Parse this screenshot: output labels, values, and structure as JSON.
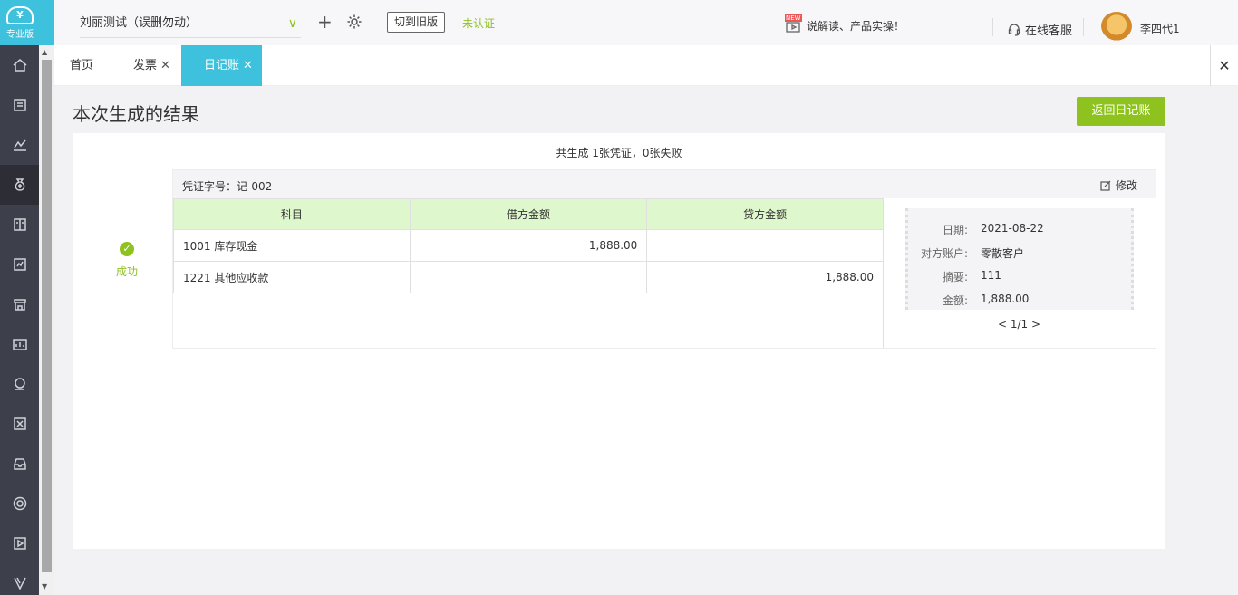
{
  "app": {
    "logo_text": "专业版",
    "company": "刘丽测试（误删勿动）",
    "switch_old_label": "切到旧版",
    "unverified": "未认证",
    "news_tag": "NEW",
    "news_text": "说解读、产品实操！",
    "service_label": "在线客服",
    "username": "李四代1"
  },
  "sidebar": {
    "items": [
      {
        "icon": "home-icon"
      },
      {
        "icon": "invoice-icon"
      },
      {
        "icon": "chart-icon"
      },
      {
        "icon": "money-bag-icon",
        "active": true
      },
      {
        "icon": "ledger-icon"
      },
      {
        "icon": "report-icon"
      },
      {
        "icon": "store-icon"
      },
      {
        "icon": "inventory-icon"
      },
      {
        "icon": "payroll-icon"
      },
      {
        "icon": "tax-icon"
      },
      {
        "icon": "archive-icon"
      },
      {
        "icon": "settings-icon"
      },
      {
        "icon": "video-icon"
      },
      {
        "icon": "v-logo-icon"
      }
    ]
  },
  "tabs": [
    {
      "label": "首页",
      "closable": false
    },
    {
      "label": "发票",
      "closable": true
    },
    {
      "label": "日记账",
      "closable": true,
      "active": true
    }
  ],
  "page": {
    "title": "本次生成的结果",
    "return_button": "返回日记账",
    "summary": "共生成 1张凭证，0张失败",
    "status_label": "成功"
  },
  "voucher": {
    "number_label": "凭证字号：记-002",
    "edit_label": "修改",
    "columns": [
      "科目",
      "借方金额",
      "贷方金额"
    ],
    "rows": [
      {
        "account": "1001 库存现金",
        "debit": "1,888.00",
        "credit": ""
      },
      {
        "account": "1221 其他应收款",
        "debit": "",
        "credit": "1,888.00"
      }
    ],
    "info": {
      "date_label": "日期:",
      "date": "2021-08-22",
      "counterparty_label": "对方账户:",
      "counterparty": "零散客户",
      "summary_label": "摘要:",
      "summary": "111",
      "amount_label": "金额:",
      "amount": "1,888.00"
    },
    "pager": "< 1/1 >"
  }
}
